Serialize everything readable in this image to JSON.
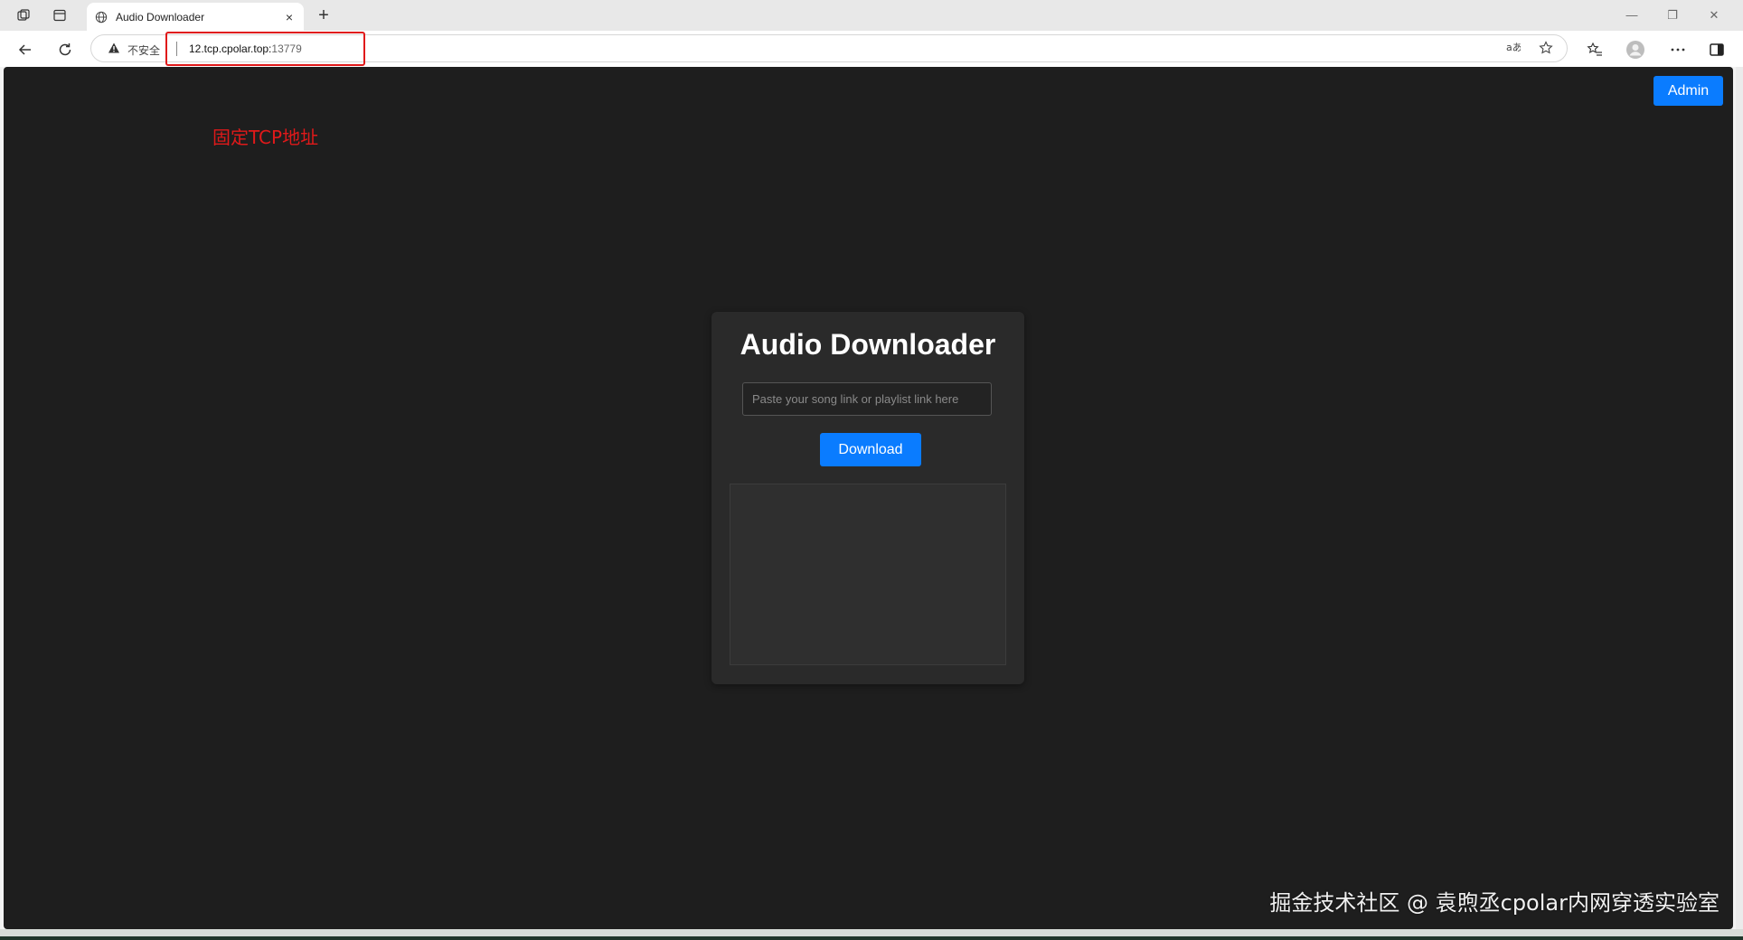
{
  "browser": {
    "tab_title": "Audio Downloader",
    "tab_close": "×",
    "new_tab": "+",
    "insecure_label": "不安全",
    "url_host": "12.tcp.cpolar.top:",
    "url_port": "13779",
    "window_minimize": "—",
    "window_restore": "❐",
    "window_close": "✕"
  },
  "page": {
    "admin_label": "Admin",
    "annotation": "固定TCP地址",
    "title": "Audio Downloader",
    "input_placeholder": "Paste your song link or playlist link here",
    "input_value": "",
    "download_label": "Download",
    "watermark": "掘金技术社区 @ 袁煦丞cpolar内网穿透实验室"
  },
  "colors": {
    "accent": "#0a7cff",
    "page_bg": "#1e1e1e",
    "card_bg": "#2a2a2a",
    "annotation": "#e0191a"
  },
  "icons": {
    "workspaces": "workspaces-icon",
    "tab_actions": "tab-actions-icon",
    "globe": "globe-icon",
    "back": "back-arrow-icon",
    "refresh": "refresh-icon",
    "warning": "warning-icon",
    "read_aloud": "read-aloud-icon",
    "favorite": "star-icon",
    "favorites": "favorites-icon",
    "profile": "profile-icon",
    "more": "more-icon",
    "sidebar": "sidebar-icon"
  }
}
